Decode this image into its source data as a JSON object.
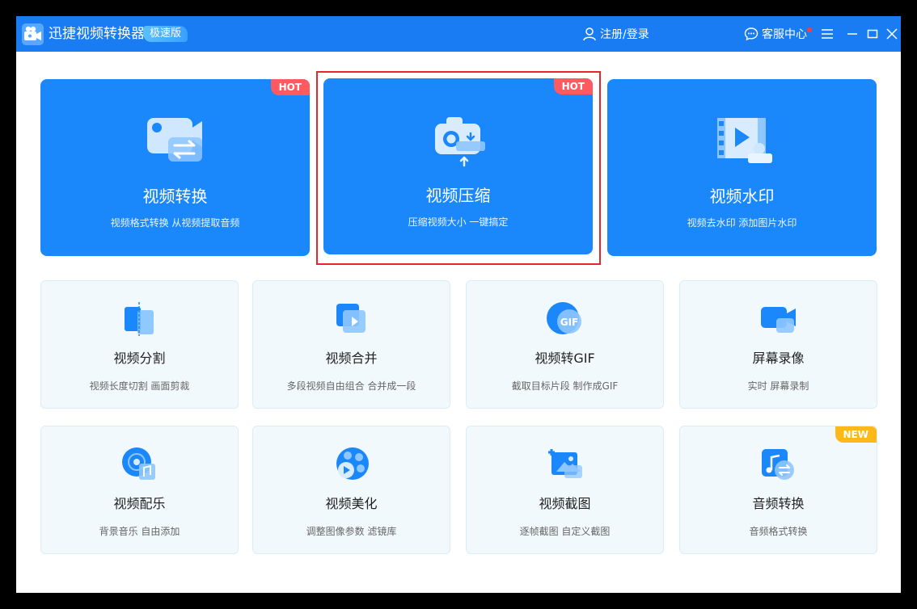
{
  "titlebar": {
    "app_name": "迅捷视频转换器",
    "edition": "极速版",
    "login_label": "注册/登录",
    "service_label": "客服中心"
  },
  "big_cards": [
    {
      "title": "视频转换",
      "desc": "视频格式转换 从视频提取音频",
      "badge": "HOT",
      "icon": "video-convert-icon"
    },
    {
      "title": "视频压缩",
      "desc": "压缩视频大小 一键搞定",
      "badge": "HOT",
      "icon": "video-compress-icon"
    },
    {
      "title": "视频水印",
      "desc": "视频去水印 添加图片水印",
      "badge": "",
      "icon": "video-watermark-icon"
    }
  ],
  "small_cards": [
    {
      "title": "视频分割",
      "desc": "视频长度切割 画面剪裁",
      "icon": "video-split-icon"
    },
    {
      "title": "视频合并",
      "desc": "多段视频自由组合 合并成一段",
      "icon": "video-merge-icon"
    },
    {
      "title": "视频转GIF",
      "desc": "截取目标片段 制作成GIF",
      "icon": "gif-icon",
      "icon_text": "GIF"
    },
    {
      "title": "屏幕录像",
      "desc": "实时 屏幕录制",
      "icon": "screen-record-icon"
    },
    {
      "title": "视频配乐",
      "desc": "背景音乐 自由添加",
      "icon": "music-disc-icon"
    },
    {
      "title": "视频美化",
      "desc": "调整图像参数 滤镜库",
      "icon": "video-beautify-icon"
    },
    {
      "title": "视频截图",
      "desc": "逐帧截图 自定义截图",
      "icon": "screenshot-icon"
    },
    {
      "title": "音频转换",
      "desc": "音频格式转换",
      "icon": "audio-convert-icon",
      "badge": "NEW"
    }
  ],
  "colors": {
    "titlebar": "#1a7cf3",
    "big_card": "#1a87fb",
    "hot_badge": "#ff5a5f",
    "new_badge": "#ffb81a",
    "highlight": "#e8262b"
  }
}
